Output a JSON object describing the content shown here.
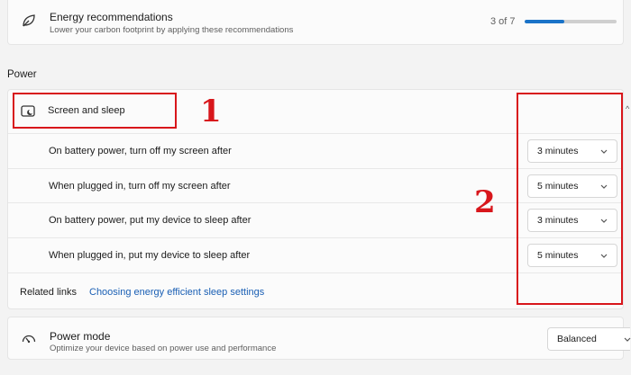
{
  "energy": {
    "title": "Energy recommendations",
    "subtitle": "Lower your carbon footprint by applying these recommendations",
    "progress_text": "3 of 7",
    "progress_fraction": 0.43,
    "icon": "leaf-icon"
  },
  "section": {
    "label": "Power"
  },
  "screen_sleep": {
    "title": "Screen and sleep",
    "icon": "screen-sleep-icon",
    "settings": [
      {
        "label": "On battery power, turn off my screen after",
        "value": "3 minutes"
      },
      {
        "label": "When plugged in, turn off my screen after",
        "value": "5 minutes"
      },
      {
        "label": "On battery power, put my device to sleep after",
        "value": "3 minutes"
      },
      {
        "label": "When plugged in, put my device to sleep after",
        "value": "5 minutes"
      }
    ],
    "related_links_label": "Related links",
    "related_link": "Choosing energy efficient sleep settings"
  },
  "power_mode": {
    "title": "Power mode",
    "subtitle": "Optimize your device based on power use and performance",
    "value": "Balanced",
    "icon": "gauge-icon"
  },
  "annotations": {
    "label1": "1",
    "label2": "2",
    "color": "#d8161b"
  },
  "colors": {
    "accent": "#1a73c8",
    "link": "#1a5fb4",
    "background": "#f3f3f3",
    "card": "#fbfbfb"
  }
}
